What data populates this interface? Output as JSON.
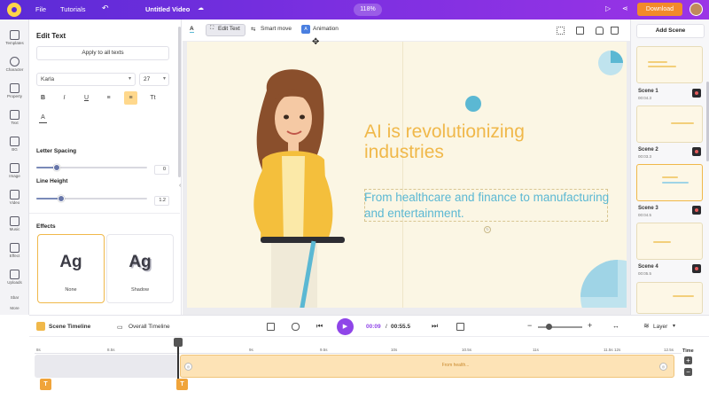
{
  "topbar": {
    "menu": [
      "File",
      "Tutorials"
    ],
    "undo_icon": "undo-icon",
    "project_title": "Untitled Video",
    "zoom": "118%",
    "download_label": "Download"
  },
  "rail": {
    "items": [
      {
        "label": "Templates",
        "icon": "templates-icon"
      },
      {
        "label": "Character",
        "icon": "character-icon"
      },
      {
        "label": "Property",
        "icon": "property-icon"
      },
      {
        "label": "Text",
        "icon": "text-icon"
      },
      {
        "label": "BG",
        "icon": "background-icon"
      },
      {
        "label": "Image",
        "icon": "image-icon"
      },
      {
        "label": "Video",
        "icon": "video-icon"
      },
      {
        "label": "Music",
        "icon": "music-icon"
      },
      {
        "label": "Effect",
        "icon": "effect-icon"
      },
      {
        "label": "Uploads",
        "icon": "uploads-icon"
      },
      {
        "label": "Sbar",
        "icon": "sbar-icon"
      },
      {
        "label": "More",
        "icon": "more-icon"
      }
    ]
  },
  "panel": {
    "title": "Edit Text",
    "apply_all": "Apply to all texts",
    "font_family": "Karla",
    "font_size": "27",
    "format_buttons": [
      "B",
      "I",
      "U",
      "≡",
      "≡",
      "Tt"
    ],
    "text_color_label": "A",
    "letter_spacing_label": "Letter Spacing",
    "letter_spacing_value": "0",
    "letter_spacing_level": 0.18,
    "line_height_label": "Line Height",
    "line_height_value": "1.2",
    "line_height_level": 0.22,
    "effects_label": "Effects",
    "effects": [
      {
        "preview": "Ag",
        "name": "None"
      },
      {
        "preview": "Ag",
        "name": "Shadow"
      }
    ]
  },
  "canvas_toolbar": {
    "text_color_label": "A",
    "edit_text": "Edit Text",
    "smart_move": "Smart move",
    "animation": "Animation",
    "right_icons": [
      "checkerboard-icon",
      "layers-icon",
      "lock-icon",
      "delete-icon"
    ]
  },
  "stage": {
    "headline": "AI is revolutionizing industries",
    "subtext": "From healthcare and finance to manufacturing and entertainment.",
    "headline_color": "#f0b84a",
    "subtext_color": "#5bb8d3",
    "background": "#fbf6e4"
  },
  "scenes": {
    "add_label": "Add Scene",
    "items": [
      {
        "name": "",
        "duration": ""
      },
      {
        "name": "Scene 1",
        "duration": "00:04.3"
      },
      {
        "name": "Scene 2",
        "duration": "00:03.3"
      },
      {
        "name": "Scene 3",
        "duration": "00:04.5"
      },
      {
        "name": "Scene 4",
        "duration": "00:05.5"
      }
    ]
  },
  "timeline": {
    "scene_timeline": "Scene Timeline",
    "overall_timeline": "Overall Timeline",
    "current_time": "00:09",
    "separator": "/",
    "total_time": "00:55.5",
    "layer_label": "Layer",
    "ticks": [
      "8s",
      "8.5s",
      "9s",
      "9.5s",
      "10s",
      "10.5s",
      "11s",
      "11.5s",
      "12s",
      "12.5s"
    ],
    "clip_label": "From health...",
    "time_label": "Time",
    "marker_label": "T"
  },
  "colors": {
    "brand_purple": "#7a2fe0",
    "download_orange": "#f28a2a",
    "accent_yellow": "#f0b84a",
    "play_purple": "#8f45e8"
  }
}
